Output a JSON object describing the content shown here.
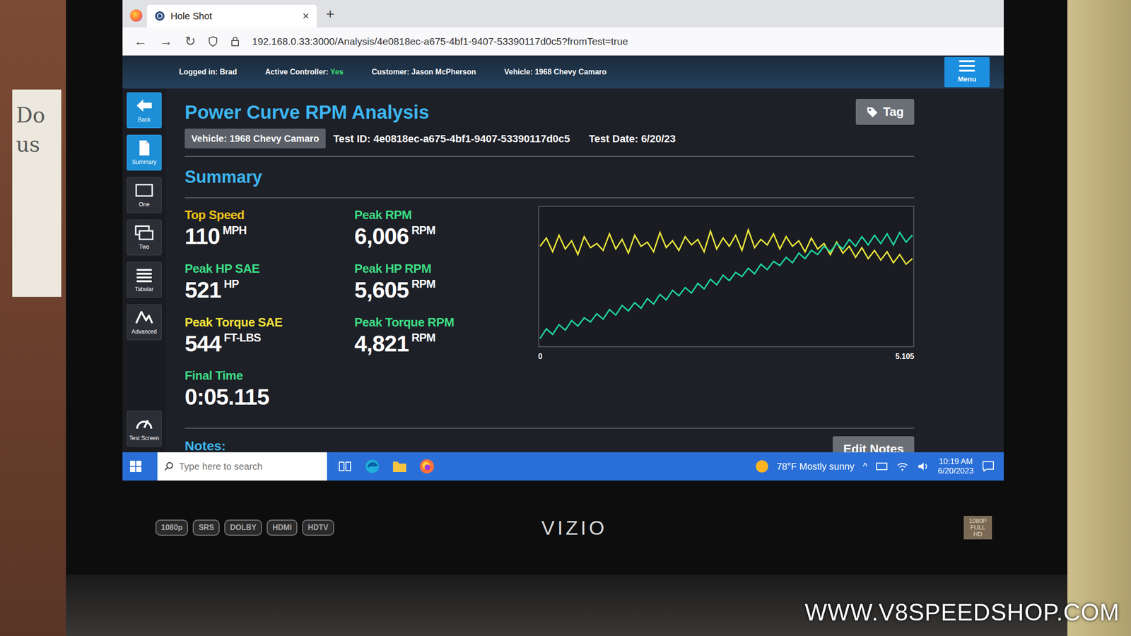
{
  "browser": {
    "tab_title": "Hole Shot",
    "tab_close": "×",
    "new_tab": "+",
    "nav": [
      "←",
      "→",
      "↻"
    ],
    "address": "192.168.0.33:3000/Analysis/4e0818ec-a675-4bf1-9407-53390117d0c5?fromTest=true"
  },
  "header": {
    "logged_in": "Logged in: Brad",
    "active_controller_label": "Active Controller:",
    "active_controller_value": "Yes",
    "customer": "Customer: Jason McPherson",
    "vehicle": "Vehicle: 1968 Chevy Camaro",
    "menu": "Menu"
  },
  "sidebar": {
    "back": "Back",
    "items": [
      {
        "label": "Summary",
        "selected": true
      },
      {
        "label": "One",
        "selected": false
      },
      {
        "label": "Two",
        "selected": false
      },
      {
        "label": "Tabular",
        "selected": false
      },
      {
        "label": "Advanced",
        "selected": false
      }
    ],
    "footer_item": "Test Screen"
  },
  "page": {
    "title": "Power Curve RPM Analysis",
    "tag": "Tag",
    "vehicle_badge": "Vehicle: 1968 Chevy Camaro",
    "test_id": "Test ID: 4e0818ec-a675-4bf1-9407-53390117d0c5",
    "test_date": "Test Date: 6/20/23",
    "summary": "Summary",
    "notes": "Notes:",
    "edit_notes": "Edit Notes"
  },
  "stats": {
    "left": [
      {
        "label": "Top Speed",
        "value": "110",
        "unit": "MPH",
        "color": "#f2c318"
      },
      {
        "label": "Peak HP SAE",
        "value": "521",
        "unit": "HP",
        "color": "#3ddc84"
      },
      {
        "label": "Peak Torque SAE",
        "value": "544",
        "unit": "FT-LBS",
        "color": "#f2e23a"
      },
      {
        "label": "Final Time",
        "value": "0:05.115",
        "unit": "",
        "color": "#3ddc84"
      }
    ],
    "right": [
      {
        "label": "Peak RPM",
        "value": "6,006",
        "unit": "RPM",
        "color": "#3ddc84"
      },
      {
        "label": "Peak HP RPM",
        "value": "5,605",
        "unit": "RPM",
        "color": "#3ddc84"
      },
      {
        "label": "Peak Torque RPM",
        "value": "4,821",
        "unit": "RPM",
        "color": "#3ddc84"
      }
    ]
  },
  "chart": {
    "x_ticks": [
      "0",
      "5.105"
    ],
    "series": [
      {
        "color": "#e8e43a",
        "values": [
          72,
          78,
          68,
          80,
          70,
          76,
          66,
          79,
          71,
          74,
          69,
          81,
          70,
          77,
          67,
          80,
          72,
          75,
          68,
          82,
          71,
          76,
          69,
          79,
          73,
          77,
          68,
          83,
          70,
          78,
          72,
          80,
          69,
          84,
          71,
          77,
          73,
          81,
          70,
          79,
          72,
          76,
          68,
          78,
          70,
          74,
          66,
          75,
          67,
          72,
          64,
          71,
          63,
          69,
          62,
          68,
          60,
          66,
          59,
          63
        ]
      },
      {
        "color": "#1fd6a0",
        "values": [
          5,
          12,
          8,
          15,
          11,
          18,
          14,
          20,
          17,
          23,
          19,
          26,
          22,
          29,
          25,
          31,
          27,
          34,
          30,
          37,
          33,
          40,
          36,
          42,
          38,
          45,
          41,
          48,
          44,
          51,
          47,
          53,
          50,
          56,
          52,
          59,
          55,
          61,
          58,
          64,
          60,
          67,
          63,
          69,
          66,
          72,
          68,
          74,
          70,
          77,
          72,
          79,
          73,
          80,
          74,
          81,
          73,
          82,
          75,
          80
        ]
      }
    ]
  },
  "taskbar": {
    "search_placeholder": "Type here to search",
    "weather": "78°F Mostly sunny",
    "tray_chevron": "^",
    "time": "10:19 AM",
    "date": "6/20/2023"
  },
  "monitor": {
    "brand": "VIZIO",
    "badges": [
      "1080p",
      "SRS",
      "DOLBY",
      "HDMI",
      "HDTV"
    ],
    "sticker": "1080P FULL HD"
  },
  "note_paper": {
    "lines": [
      "Do",
      "us"
    ]
  },
  "watermark": "WWW.V8SPEEDSHOP.COM"
}
